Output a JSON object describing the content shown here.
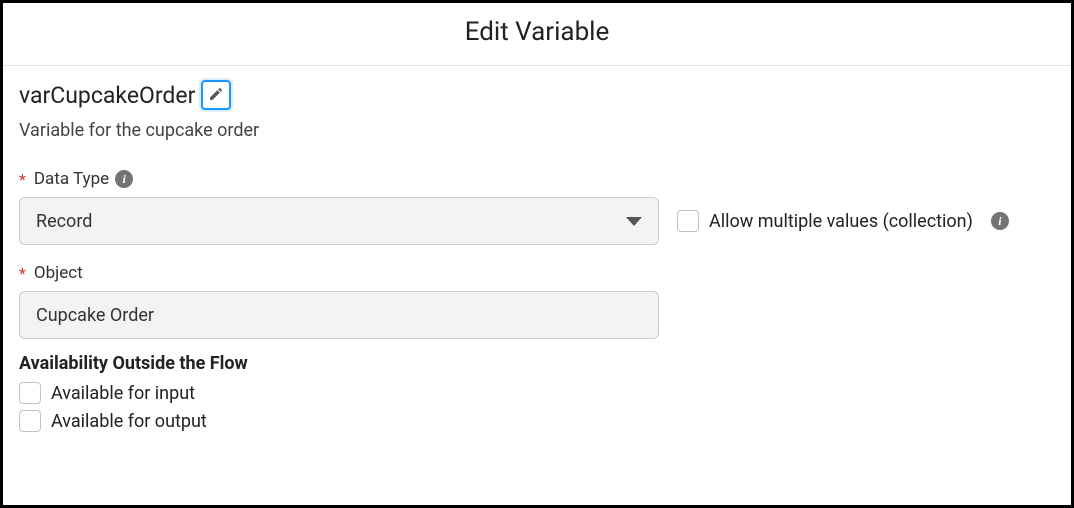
{
  "header": {
    "title": "Edit Variable"
  },
  "variable": {
    "name": "varCupcakeOrder",
    "description": "Variable for the cupcake order"
  },
  "fields": {
    "dataType": {
      "label": "Data Type",
      "value": "Record",
      "required": true
    },
    "allowMultiple": {
      "label": "Allow multiple values (collection)",
      "checked": false
    },
    "object": {
      "label": "Object",
      "value": "Cupcake Order",
      "required": true
    }
  },
  "availability": {
    "heading": "Availability Outside the Flow",
    "input": {
      "label": "Available for input",
      "checked": false
    },
    "output": {
      "label": "Available for output",
      "checked": false
    }
  }
}
